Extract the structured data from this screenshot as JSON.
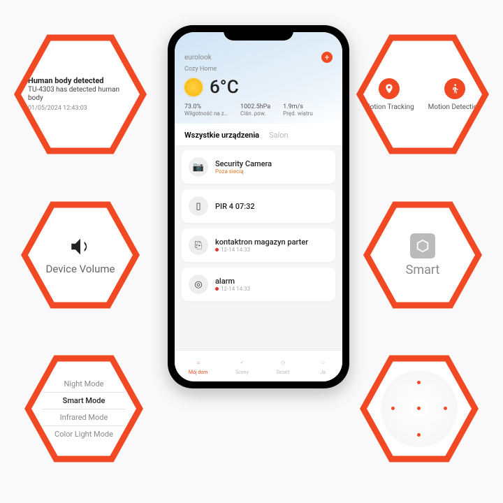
{
  "colors": {
    "accent": "#f04923"
  },
  "hex": {
    "notification": {
      "title": "Human body detected",
      "body": "TU-4303 has detected human body",
      "time": "01/05/2024 12:43:03"
    },
    "volume": {
      "label": "Device Volume"
    },
    "modes": {
      "items": [
        "Night Mode",
        "Smart Mode",
        "Infrared Mode",
        "Color Light Mode"
      ],
      "active_index": 1
    },
    "motion": {
      "tracking_label": "Motion Tracking",
      "detection_label": "Motion Detection"
    },
    "smart": {
      "label": "Smart"
    }
  },
  "phone": {
    "brand": "eurolook",
    "home_label": "Cozy Home",
    "temp": "6°C",
    "metrics": [
      {
        "value": "73.0%",
        "label": "Wilgotność na z…"
      },
      {
        "value": "1002.5hPa",
        "label": "Ciśn. pow."
      },
      {
        "value": "1.9m/s",
        "label": "Pręd. wiatru"
      }
    ],
    "tabs": {
      "all": "Wszystkie urządzenia",
      "room": "Salon"
    },
    "devices": [
      {
        "name": "Security Camera",
        "sub": "Poza siecią",
        "sub_style": "warn",
        "icon": "📷"
      },
      {
        "name": "PIR 4 07:32",
        "sub": "",
        "sub_style": "normal",
        "icon": "▯"
      },
      {
        "name": "kontaktron magazyn parter",
        "sub": "12-14 14:33",
        "sub_style": "dot",
        "icon": "⎘"
      },
      {
        "name": "alarm",
        "sub": "12-14 14:33",
        "sub_style": "dot",
        "icon": "◎"
      }
    ],
    "bottom_nav": [
      {
        "label": "Mój dom",
        "icon": "⌂",
        "active": true
      },
      {
        "label": "Sceny",
        "icon": "✓",
        "active": false
      },
      {
        "label": "Smart",
        "icon": "◷",
        "active": false
      },
      {
        "label": "Ja",
        "icon": "☺",
        "active": false
      }
    ]
  }
}
